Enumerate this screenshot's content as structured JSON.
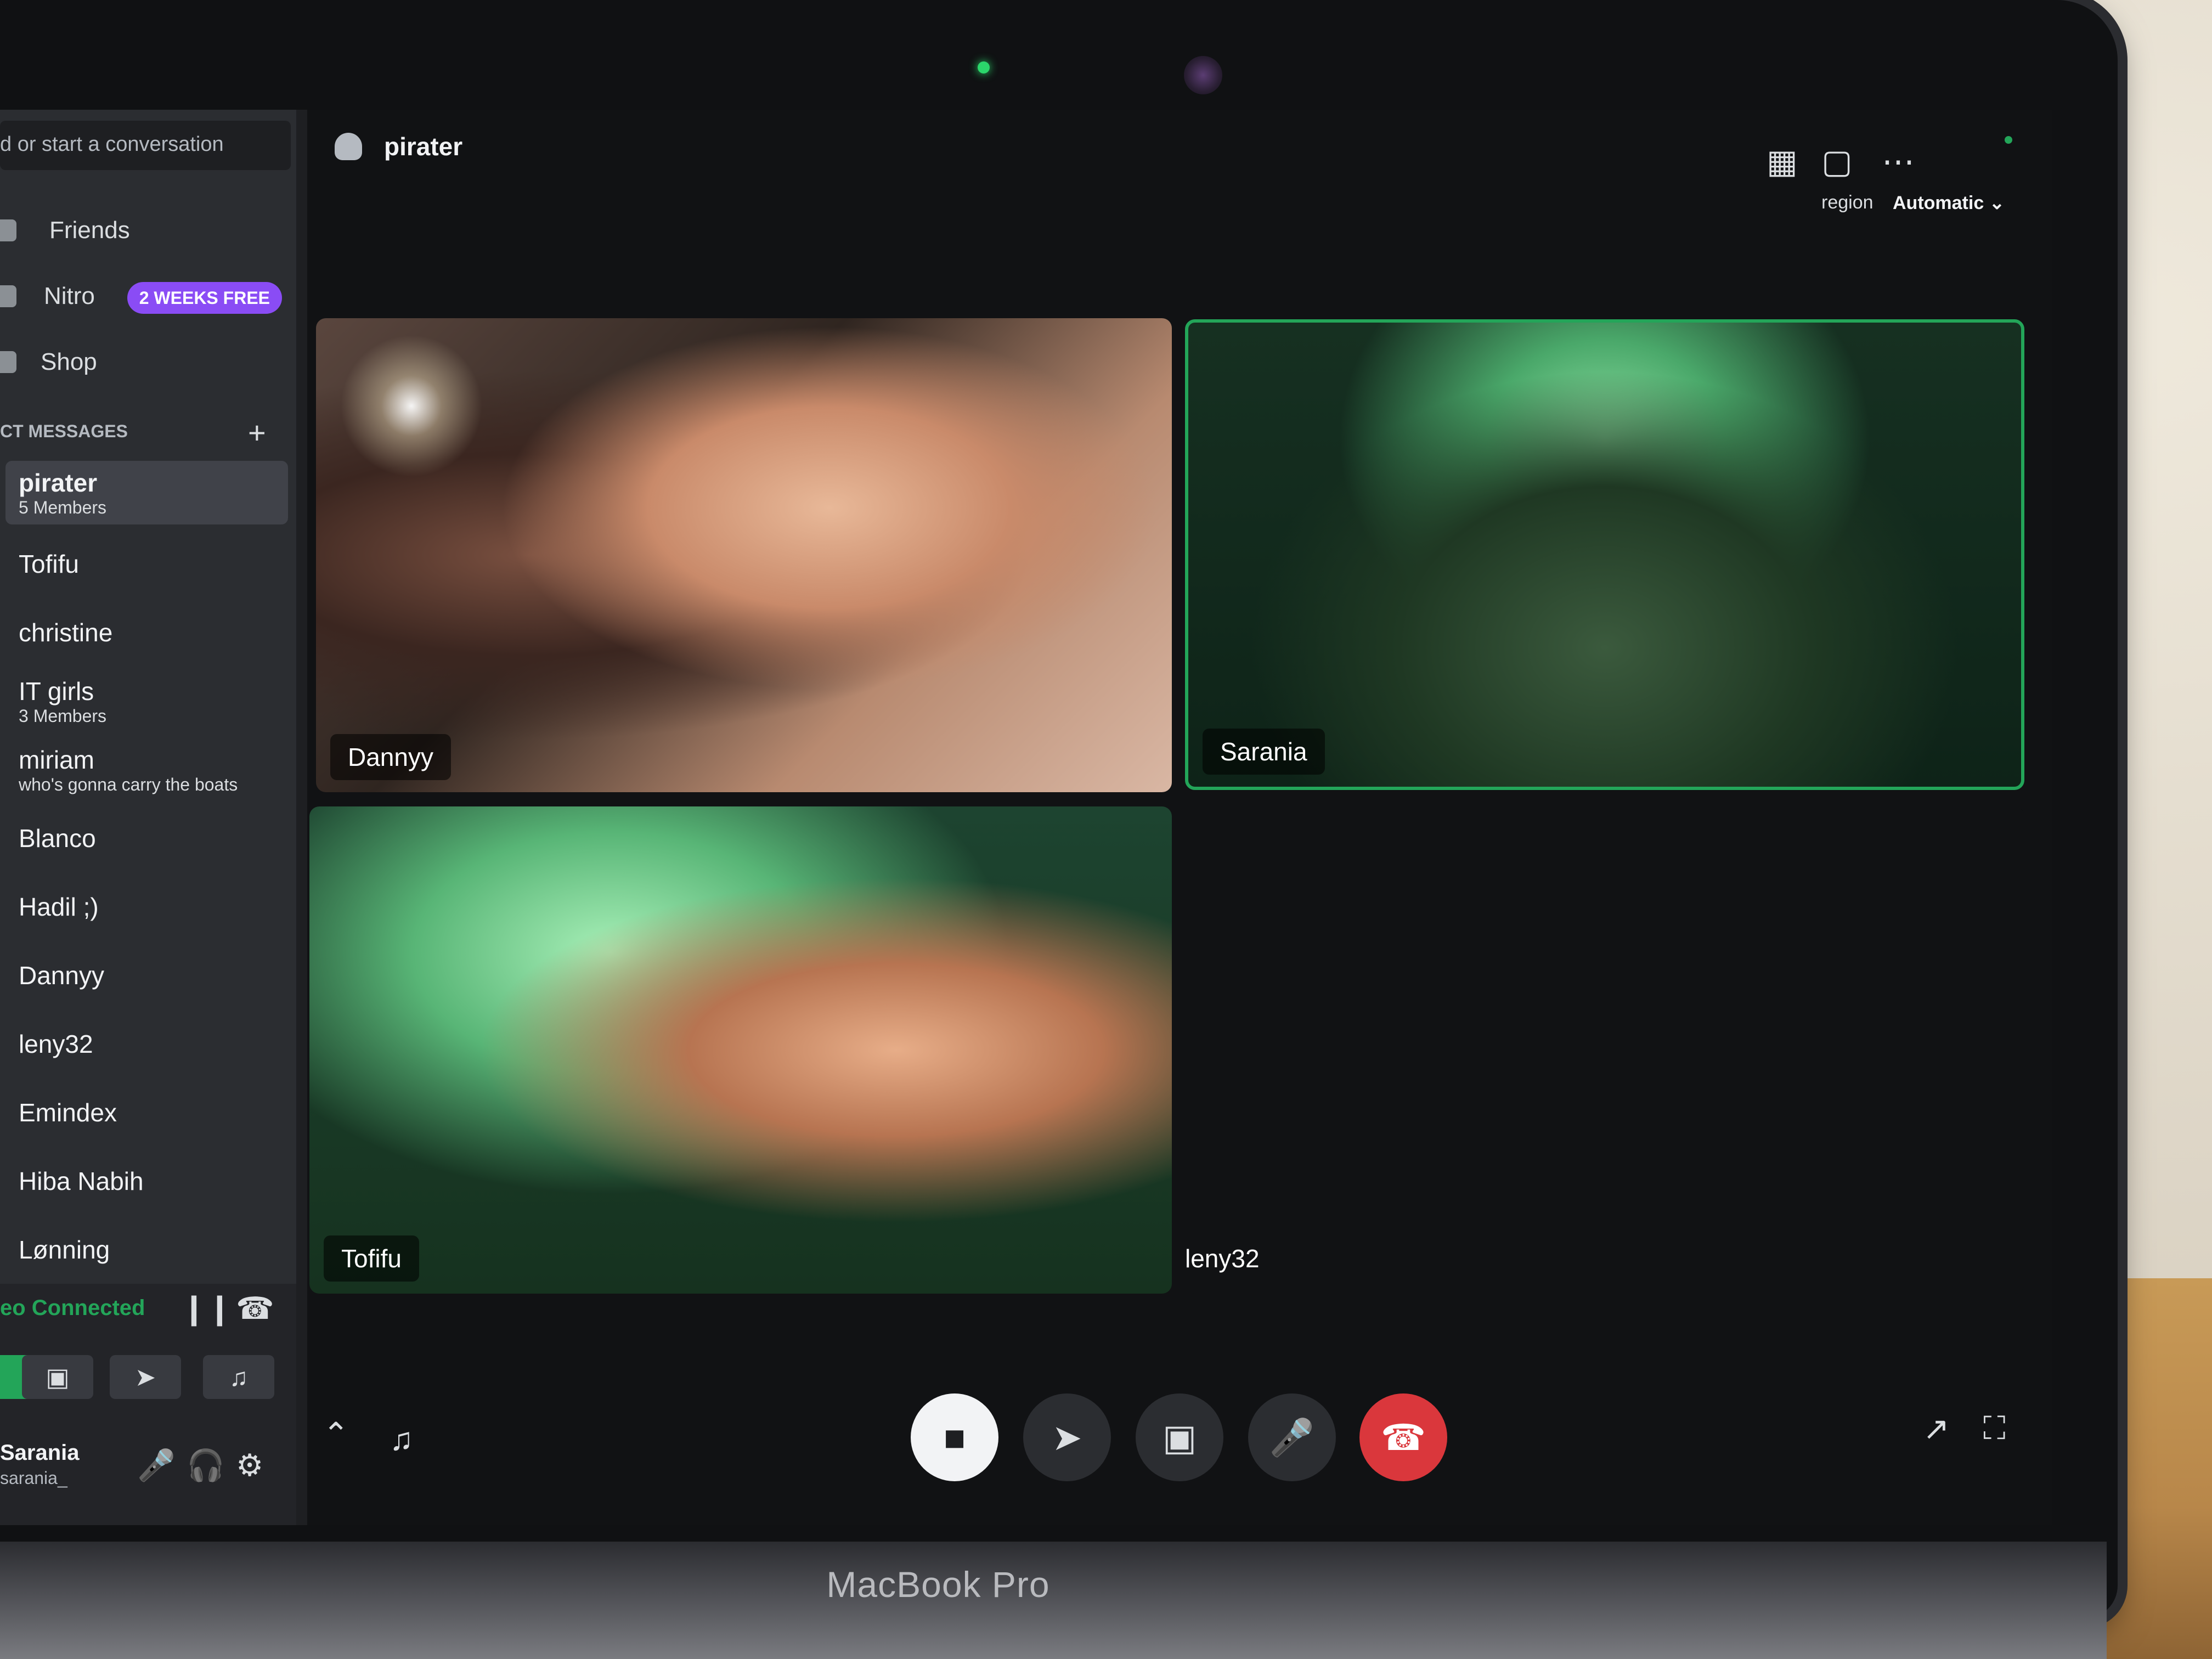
{
  "device": {
    "label": "MacBook Pro"
  },
  "sidebar": {
    "search_placeholder": "d or start a conversation",
    "nav": [
      {
        "label": "Friends",
        "icon": "friends-icon"
      },
      {
        "label": "Nitro",
        "icon": "nitro-icon",
        "badge": "2 WEEKS FREE"
      },
      {
        "label": "Shop",
        "icon": "shop-icon"
      }
    ],
    "dm_header": "CT MESSAGES",
    "dms": [
      {
        "name": "pirater",
        "sub": "5 Members",
        "active": true
      },
      {
        "name": "Tofifu",
        "sub": ""
      },
      {
        "name": "christine",
        "sub": ""
      },
      {
        "name": "IT girls",
        "sub": "3 Members"
      },
      {
        "name": "miriam",
        "sub": "who's gonna carry the boats"
      },
      {
        "name": "Blanco",
        "sub": ""
      },
      {
        "name": "Hadil ;)",
        "sub": ""
      },
      {
        "name": "Dannyy",
        "sub": ""
      },
      {
        "name": "leny32",
        "sub": ""
      },
      {
        "name": "Emindex",
        "sub": ""
      },
      {
        "name": "Hiba Nabih",
        "sub": ""
      },
      {
        "name": "Lønning",
        "sub": ""
      }
    ],
    "voice": {
      "status": "eo Connected"
    },
    "user": {
      "name": "Sarania",
      "tag": "sarania_"
    }
  },
  "call": {
    "title": "pirater",
    "region_label": "region",
    "region_value": "Automatic",
    "participants": [
      {
        "name": "Dannyy",
        "video": true
      },
      {
        "name": "Sarania",
        "video": true,
        "speaking": true
      },
      {
        "name": "Tofifu",
        "video": true
      },
      {
        "name": "leny32",
        "video": false
      }
    ]
  },
  "colors": {
    "accent_green": "#23a559",
    "leave_red": "#da373c",
    "nitro_purple": "#8a4cf5"
  }
}
